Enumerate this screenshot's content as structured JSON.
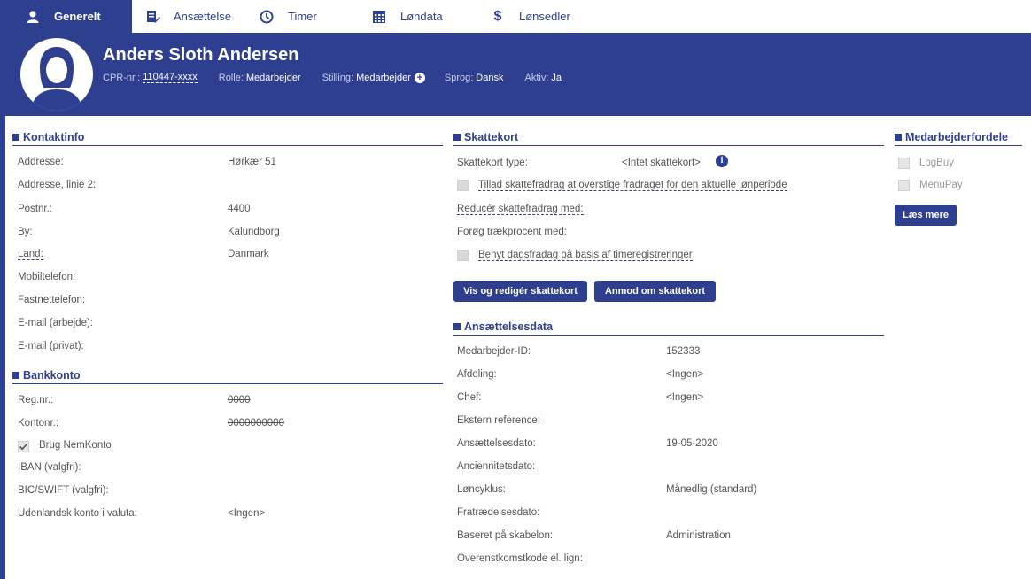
{
  "tabs": [
    {
      "label": "Generelt",
      "icon": "person-icon",
      "active": true
    },
    {
      "label": "Ansættelse",
      "icon": "edit-document-icon",
      "active": false
    },
    {
      "label": "Timer",
      "icon": "clock-icon",
      "active": false
    },
    {
      "label": "Løndata",
      "icon": "table-icon",
      "active": false
    },
    {
      "label": "Lønsedler",
      "icon": "dollar-icon",
      "active": false
    }
  ],
  "employee": {
    "name": "Anders Sloth Andersen",
    "cpr_label": "CPR-nr.:",
    "cpr_value": "110447-xxxx",
    "role_label": "Rolle:",
    "role_value": "Medarbejder",
    "position_label": "Stilling:",
    "position_value": "Medarbejder",
    "language_label": "Sprog:",
    "language_value": "Dansk",
    "active_label": "Aktiv:",
    "active_value": "Ja"
  },
  "contact": {
    "title": "Kontaktinfo",
    "rows": [
      {
        "label": "Addresse:",
        "value": "Hørkær 51"
      },
      {
        "label": "Addresse, linie 2:",
        "value": ""
      },
      {
        "label": "Postnr.:",
        "value": "4400"
      },
      {
        "label": "By:",
        "value": "Kalundborg"
      },
      {
        "label": "Land:",
        "value": "Danmark"
      },
      {
        "label": "Mobiltelefon:",
        "value": ""
      },
      {
        "label": "Fastnettelefon:",
        "value": ""
      },
      {
        "label": "E-mail (arbejde):",
        "value": ""
      },
      {
        "label": "E-mail (privat):",
        "value": ""
      }
    ]
  },
  "bank": {
    "title": "Bankkonto",
    "reg_label": "Reg.nr.:",
    "reg_value": "0000",
    "account_label": "Kontonr.:",
    "account_value": "0000000000",
    "nemkonto_label": "Brug NemKonto",
    "iban_label": "IBAN (valgfri):",
    "bic_label": "BIC/SWIFT (valgfri):",
    "foreign_label": "Udenlandsk konto i valuta:",
    "foreign_value": "<Ingen>"
  },
  "taxcard": {
    "title": "Skattekort",
    "type_label": "Skattekort type:",
    "type_value": "<Intet skattekort>",
    "allow_label": "Tillad skattefradrag at overstige fradraget for den aktuelle lønperiode",
    "reduce_label": "Reducér skattefradrag med:",
    "increase_label": "Forøg trækprocent med:",
    "daily_label": "Benyt dagsfradag på basis af timeregistreringer",
    "view_button": "Vis og redigér skattekort",
    "request_button": "Anmod om skattekort"
  },
  "employment": {
    "title": "Ansættelsesdata",
    "rows": [
      {
        "label": "Medarbejder-ID:",
        "value": "152333"
      },
      {
        "label": "Afdeling:",
        "value": "<Ingen>"
      },
      {
        "label": "Chef:",
        "value": "<Ingen>"
      },
      {
        "label": "Ekstern reference:",
        "value": ""
      },
      {
        "label": "Ansættelsesdato:",
        "value": "19-05-2020"
      },
      {
        "label": "Anciennitetsdato:",
        "value": ""
      },
      {
        "label": "Løncyklus:",
        "value": "Månedlig (standard)"
      },
      {
        "label": "Fratrædelsesdato:",
        "value": ""
      },
      {
        "label": "Baseret på skabelon:",
        "value": "Administration"
      },
      {
        "label": "Overenstkomstkode el. lign:",
        "value": ""
      }
    ]
  },
  "benefits": {
    "title": "Medarbejderfordele",
    "items": [
      {
        "label": "LogBuy"
      },
      {
        "label": "MenuPay"
      }
    ],
    "read_more_button": "Læs mere"
  },
  "colors": {
    "primary": "#2f3f8f",
    "text": "#555555",
    "checkbox": "#d9d9d9"
  }
}
